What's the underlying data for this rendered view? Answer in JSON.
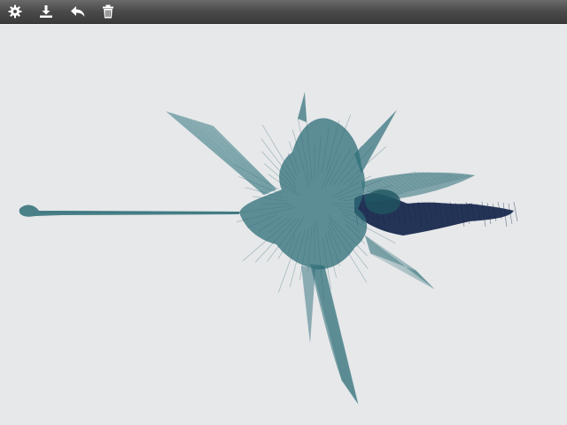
{
  "toolbar": {
    "buttons": [
      {
        "icon": "gear-icon",
        "tooltip": ""
      },
      {
        "icon": "download-icon",
        "tooltip": ""
      },
      {
        "icon": "undo-icon",
        "tooltip": ""
      },
      {
        "icon": "trash-icon",
        "tooltip": ""
      }
    ],
    "icon_color": "#ffffff"
  },
  "canvas": {
    "background": "#e6e8ea",
    "stroke_colors": {
      "teal": "#2e6e77",
      "dark_teal": "#1f5560",
      "navy": "#14244a"
    }
  }
}
